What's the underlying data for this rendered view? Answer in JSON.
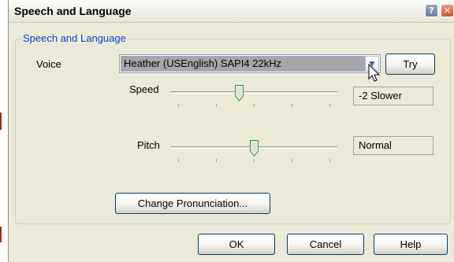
{
  "window": {
    "title": "Speech and Language"
  },
  "titlebar_buttons": {
    "help_glyph": "?",
    "close_glyph": "✕"
  },
  "group": {
    "label": "Speech and Language"
  },
  "voice": {
    "label": "Voice",
    "selected": "Heather (USEnglish) SAPI4 22kHz",
    "try_label": "Try"
  },
  "speed": {
    "label": "Speed",
    "value_text": "-2 Slower",
    "level": 0.4,
    "ticks": 5
  },
  "pitch": {
    "label": "Pitch",
    "value_text": "Normal",
    "level": 0.5,
    "ticks": 5
  },
  "pronunciation": {
    "button_label": "Change Pronunciation..."
  },
  "footer": {
    "ok_label": "OK",
    "cancel_label": "Cancel",
    "help_label": "Help"
  },
  "colors": {
    "group_label": "#0046d5",
    "dialog_bg": "#ece9d8",
    "button_border": "#003c74",
    "thumb": "#21a121"
  }
}
